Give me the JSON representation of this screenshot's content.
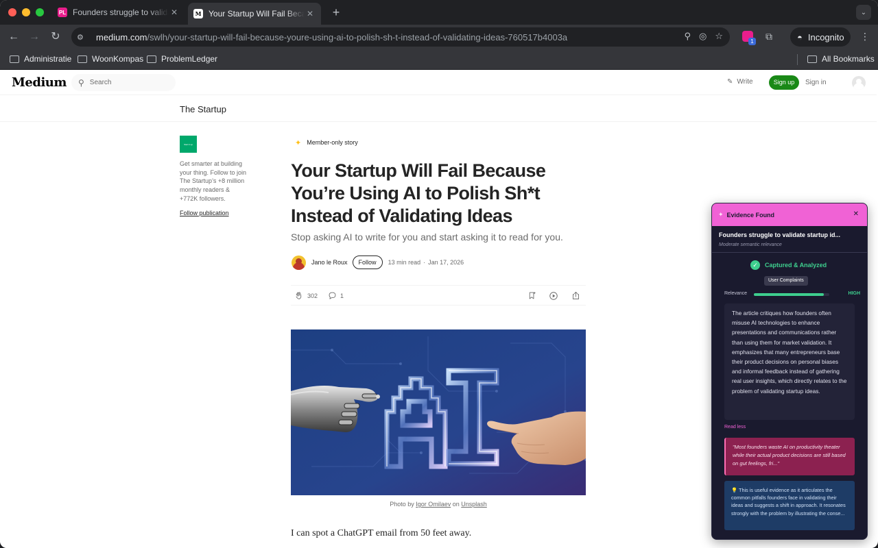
{
  "browser": {
    "tabs": [
      {
        "title": "Founders struggle to validate",
        "favicon": "PL",
        "active": false
      },
      {
        "title": "Your Startup Will Fail Because",
        "favicon": "M",
        "active": true
      }
    ],
    "url_domain": "medium.com",
    "url_path": "/swlh/your-startup-will-fail-because-youre-using-ai-to-polish-sh-t-instead-of-validating-ideas-760517b4003a",
    "ext_badge": "1",
    "incognito_label": "Incognito",
    "bookmarks": [
      "Administratie",
      "WoonKompas",
      "ProblemLedger"
    ],
    "all_bookmarks": "All Bookmarks"
  },
  "medium": {
    "logo": "Medium",
    "search_placeholder": "Search",
    "write": "Write",
    "signup": "Sign up",
    "signin": "Sign in",
    "publication": "The Startup",
    "side_logo_text": "Start it up",
    "side_desc": "Get smarter at building your thing. Follow to join The Startup’s +8 million monthly readers & +772K followers.",
    "follow_publication": "Follow publication"
  },
  "article": {
    "member_label": "Member-only story",
    "title": "Your Startup Will Fail Because You’re Using AI to Polish Sh*t Instead of Validating Ideas",
    "subtitle": "Stop asking AI to write for you and start asking it to read for you.",
    "author": "Jano le Roux",
    "follow": "Follow",
    "read_time": "13 min read",
    "date": "Jan 17, 2026",
    "claps": "302",
    "comments": "1",
    "caption_prefix": "Photo by ",
    "caption_author": "Igor Omilaev",
    "caption_mid": " on ",
    "caption_source": "Unsplash",
    "first_line": "I can spot a ChatGPT email from 50 feet away."
  },
  "panel": {
    "title": "Evidence Found",
    "problem": "Founders struggle to validate startup id...",
    "relevance_note": "Moderate semantic relevance",
    "status": "Captured & Analyzed",
    "category": "User Complaints",
    "relevance_label": "Relevance",
    "relevance_level": "HIGH",
    "relevance_fraction": 0.93,
    "summary": "The article critiques how founders often misuse AI technologies to enhance presentations and communications rather than using them for market validation. It emphasizes that many entrepreneurs base their product decisions on personal biases and informal feedback instead of gathering real user insights, which directly relates to the problem of validating startup ideas.",
    "read_less": "Read less",
    "quote": "\"Most founders waste AI on productivity theater while their actual product decisions are still based on gut feelings, fri...\"",
    "insight": "💡 This is useful evidence as it articulates the common pitfalls founders face in validating their ideas and suggests a shift in approach. It resonates strongly with the problem by illustrating the conse..."
  },
  "colors": {
    "medium_green": "#1a8917",
    "panel_accent": "#f062d5",
    "success": "#3ecf8e"
  }
}
